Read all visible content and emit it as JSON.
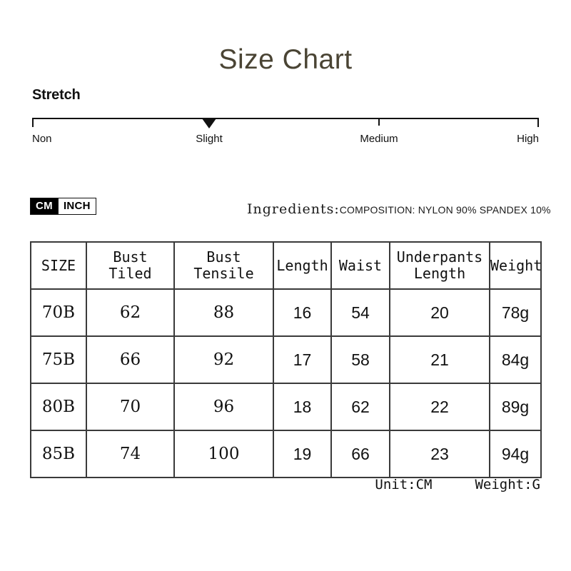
{
  "title": "Size Chart",
  "stretch": {
    "label": "Stretch",
    "scale_labels": [
      "Non",
      "Slight",
      "Medium",
      "High"
    ],
    "selected": "Slight",
    "marker_icon": "triangle-down-marker"
  },
  "units": {
    "options": [
      "CM",
      "INCH"
    ],
    "selected": "CM"
  },
  "ingredients": {
    "label": "Ingredients:",
    "value": "COMPOSITION: NYLON 90% SPANDEX 10%"
  },
  "table": {
    "headers": [
      "SIZE",
      "Bust\nTiled",
      "Bust\nTensile",
      "Length",
      "Waist",
      "Underpants\nLength",
      "Weight"
    ],
    "header_lines": [
      [
        "SIZE"
      ],
      [
        "Bust",
        "Tiled"
      ],
      [
        "Bust",
        "Tensile"
      ],
      [
        "Length"
      ],
      [
        "Waist"
      ],
      [
        "Underpants",
        "Length"
      ],
      [
        "Weight"
      ]
    ],
    "rows": [
      {
        "size": "70B",
        "bust_tiled": "62",
        "bust_tensile": "88",
        "length": "16",
        "waist": "54",
        "underpants_length": "20",
        "weight": "78g"
      },
      {
        "size": "75B",
        "bust_tiled": "66",
        "bust_tensile": "92",
        "length": "17",
        "waist": "58",
        "underpants_length": "21",
        "weight": "84g"
      },
      {
        "size": "80B",
        "bust_tiled": "70",
        "bust_tensile": "96",
        "length": "18",
        "waist": "62",
        "underpants_length": "22",
        "weight": "89g"
      },
      {
        "size": "85B",
        "bust_tiled": "74",
        "bust_tensile": "100",
        "length": "19",
        "waist": "66",
        "underpants_length": "23",
        "weight": "94g"
      }
    ]
  },
  "footer": {
    "unit_note": "Unit:CM",
    "weight_note": "Weight:G"
  },
  "colors": {
    "title": "#4a4434",
    "text": "#111111",
    "border": "#3a3a3a",
    "toggle_active_bg": "#000000"
  }
}
